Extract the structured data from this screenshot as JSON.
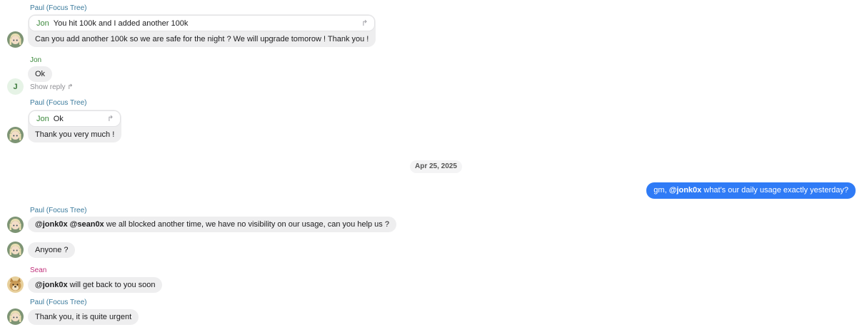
{
  "messages": {
    "m1": {
      "sender": "Paul (Focus Tree)",
      "quote_author": "Jon",
      "quote_text": "You hit 100k and I added another 100k",
      "text": "Can you add another 100k so we are safe for the night ? We will upgrade tomorow ! Thank you !"
    },
    "m2": {
      "sender": "Jon",
      "avatar_letter": "J",
      "text": "Ok",
      "show_reply": "Show reply"
    },
    "m3": {
      "sender": "Paul (Focus Tree)",
      "quote_author": "Jon",
      "quote_text": "Ok",
      "text": "Thank you very much !"
    },
    "date_divider": "Apr 25, 2025",
    "outgoing": {
      "prefix": "gm, ",
      "mention": "@jonk0x",
      "suffix": " what's our daily usage exactly yesterday?"
    },
    "m4": {
      "sender": "Paul (Focus Tree)",
      "mention1": "@jonk0x",
      "mention2": "@sean0x",
      "suffix": " we all blocked another time, we have no visibility on our usage, can you help us ?"
    },
    "m5": {
      "text": "Anyone ?"
    },
    "m6": {
      "sender": "Sean",
      "mention": "@jonk0x",
      "suffix": " will get back to you soon"
    },
    "m7": {
      "sender": "Paul (Focus Tree)",
      "text": "Thank you, it is quite urgent"
    }
  },
  "icons": {
    "forward": "↱",
    "show_reply_arrow": "↱"
  },
  "colors": {
    "paul_name": "#3a7a9c",
    "jon_name": "#3d8a3d",
    "sean_name": "#c0307a",
    "outgoing_bubble": "#2f7bf6",
    "incoming_bubble": "#eeeeef"
  }
}
